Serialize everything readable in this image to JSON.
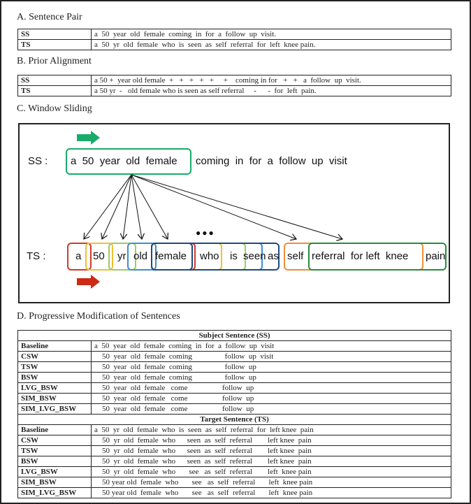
{
  "section_a": {
    "title": "A. Sentence Pair",
    "rows": [
      {
        "label": "SS",
        "text": "a  50  year  old  female  coming  in  for  a  follow  up  visit."
      },
      {
        "label": "TS",
        "text": "a  50  yr  old  female  who  is  seen  as  self  referral  for  left  knee pain."
      }
    ]
  },
  "section_b": {
    "title": "B. Prior Alignment",
    "rows": [
      {
        "label": "SS",
        "text": "a 50 +  year old female  +   +   +   +   +     +    coming in for   +   +   a  follow  up  visit."
      },
      {
        "label": "TS",
        "text": "a 50 yr  -   old female who is seen as self referral     -      -  for  left  pain."
      }
    ]
  },
  "section_c": {
    "title": "C. Window Sliding",
    "ss_label": "SS :",
    "ts_label": "TS :",
    "ss_window_text": "a  50  year  old  female",
    "ss_rest_text": "coming  in  for  a  follow  up  visit",
    "ellipsis": "●●●",
    "ts_tokens": [
      "a",
      "50",
      "yr",
      "old",
      "female",
      "who",
      "is",
      "seen",
      "as",
      "self",
      "referral  for left  knee",
      "pain"
    ],
    "colors": {
      "ss_window": "#1aab6a",
      "ss_arrow": "#1aab6a",
      "ts_arrow": "#cc2a14",
      "red": "#d03a2a",
      "yellow": "#f0c030",
      "light_green": "#9ccc65",
      "light_blue": "#3d8fd0",
      "dark_blue": "#1e4a80",
      "orange": "#e8903a",
      "green": "#2a8a3a"
    }
  },
  "section_d": {
    "title": "D. Progressive Modification of Sentences",
    "ss_header": "Subject Sentence (SS)",
    "ts_header": "Target Sentence (TS)",
    "ss_rows": [
      {
        "label": "Baseline",
        "text": "a  50  year  old  female  coming  in  for  a  follow  up  visit"
      },
      {
        "label": "CSW",
        "text": "    50  year  old  female  coming                 follow  up  visit"
      },
      {
        "label": "TSW",
        "text": "    50  year  old  female  coming                 follow  up"
      },
      {
        "label": "BSW",
        "text": "    50  year  old  female  coming                 follow  up"
      },
      {
        "label": "LVG_BSW",
        "text": "    50  year  old  female   come                  follow  up"
      },
      {
        "label": "SIM_BSW",
        "text": "    50  year  old  female   come                  follow  up"
      },
      {
        "label": "SIM_LVG_BSW",
        "text": "    50  year  old  female   come                  follow  up"
      }
    ],
    "ts_rows": [
      {
        "label": "Baseline",
        "text": "a  50  yr  old  female  who  is  seen  as  self  referral  for  left knee  pain"
      },
      {
        "label": "CSW",
        "text": "    50  yr  old  female  who      seen  as  self  referral        left knee  pain"
      },
      {
        "label": "TSW",
        "text": "    50  yr  old  female  who      seen  as  self  referral        left knee  pain"
      },
      {
        "label": "BSW",
        "text": "    50  yr  old  female  who      seen  as  self  referral        left knee  pain"
      },
      {
        "label": "LVG_BSW",
        "text": "    50  yr  old  female  who       see   as  self  referral        left  knee pain"
      },
      {
        "label": "SIM_BSW",
        "text": "    50 year old  female  who       see   as  self  referral       left  knee pain"
      },
      {
        "label": "SIM_LVG_BSW",
        "text": "    50 year old  female  who       see   as  self  referral       left  knee pain"
      }
    ]
  }
}
